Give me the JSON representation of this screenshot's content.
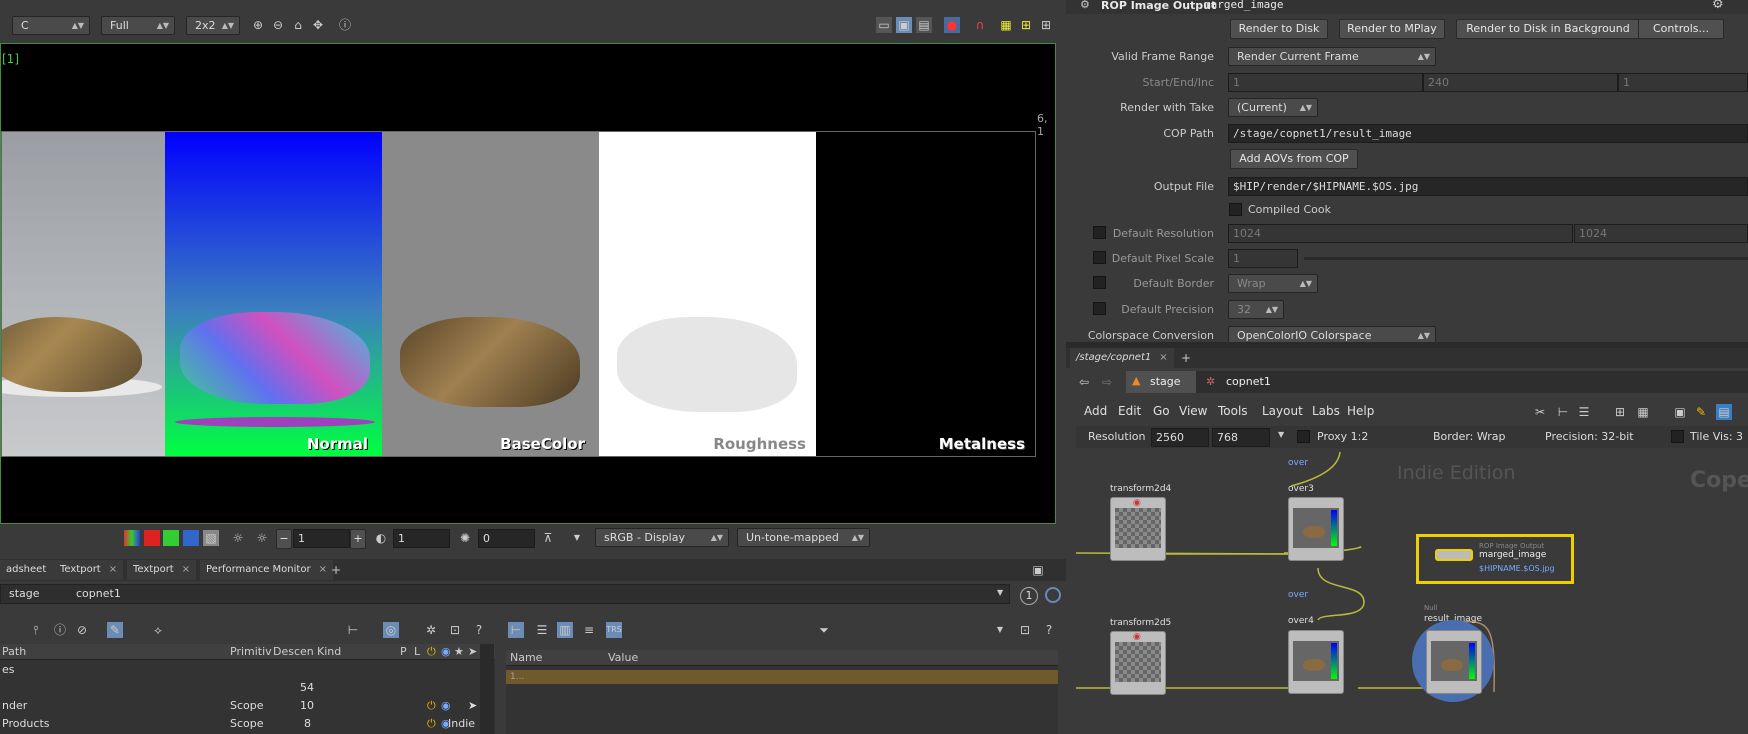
{
  "viewer_toolbar": {
    "channel": "C",
    "resolution": "Full",
    "layout": "2x2",
    "frame_label": "[1]",
    "coord_readout": "6, 1"
  },
  "viewer_images": {
    "labels": [
      "Normal",
      "BaseColor",
      "Roughness",
      "Metalness"
    ]
  },
  "viewer_bottom": {
    "value1": "1",
    "value2": "1",
    "value3": "0",
    "display": "sRGB - Display",
    "tonemap": "Un-tone-mapped"
  },
  "bottom_tabs": [
    {
      "label": "adsheet"
    },
    {
      "label": "Textport"
    },
    {
      "label": "Textport"
    },
    {
      "label": "Performance Monitor"
    }
  ],
  "bottom_path": {
    "stage": "stage",
    "copnet": "copnet1",
    "badge": "1"
  },
  "scene_table": {
    "headers": [
      "Path",
      "Primitiv",
      "Descen",
      "Kind",
      "P",
      "L"
    ],
    "rows": [
      {
        "path": "es",
        "prim": "",
        "desc": "",
        "kind": ""
      },
      {
        "path": "",
        "prim": "",
        "desc": "54",
        "kind": ""
      },
      {
        "path": "nder",
        "prim": "Scope",
        "desc": "10",
        "kind": ""
      },
      {
        "path": "Products",
        "prim": "Scope",
        "desc": "8",
        "kind": ""
      }
    ],
    "indie": "Indie"
  },
  "details_table": {
    "headers": [
      "Name",
      "Value"
    ],
    "placeholder": "1..."
  },
  "params": {
    "node_type": "ROP Image Output",
    "node_name": "marged_image",
    "buttons": [
      "Render to Disk",
      "Render to MPlay",
      "Render to Disk in Background",
      "Controls..."
    ],
    "valid_frame_range_label": "Valid Frame Range",
    "valid_frame_range": "Render Current Frame",
    "start_end_inc_label": "Start/End/Inc",
    "start": "1",
    "end": "240",
    "inc": "1",
    "render_with_take_label": "Render with Take",
    "render_with_take": "(Current)",
    "cop_path_label": "COP Path",
    "cop_path": "/stage/copnet1/result_image",
    "add_aovs": "Add AOVs from COP",
    "output_file_label": "Output File",
    "output_file": "$HIP/render/$HIPNAME.$OS.jpg",
    "compiled_cook": "Compiled Cook",
    "default_resolution_label": "Default Resolution",
    "res_x": "1024",
    "res_y": "1024",
    "default_pixel_scale_label": "Default Pixel Scale",
    "pixel_scale": "1",
    "default_border_label": "Default Border",
    "border": "Wrap",
    "default_precision_label": "Default Precision",
    "precision": "32",
    "colorspace_label": "Colorspace Conversion",
    "colorspace": "OpenColorIO Colorspace"
  },
  "network": {
    "tab_path": "/stage/copnet1",
    "crumb_stage": "stage",
    "crumb_copnet": "copnet1",
    "menu": [
      "Add",
      "Edit",
      "Go",
      "View",
      "Tools",
      "Layout",
      "Labs",
      "Help"
    ],
    "resolution_label": "Resolution",
    "res_w": "2560",
    "res_h": "768",
    "proxy": "Proxy 1:2",
    "border": "Border: Wrap",
    "precision": "Precision: 32-bit",
    "tile_vis": "Tile Vis: 3",
    "watermark": "Indie Edition",
    "watermark2": "Cope",
    "nodes": {
      "transform2d4": "transform2d4",
      "transform2d5": "transform2d5",
      "over3_type": "over",
      "over3": "over3",
      "over4_type": "over",
      "over4": "over4",
      "rop_type": "ROP Image Output",
      "rop_name": "marged_image",
      "rop_file": "$HIPNAME.$OS.jpg",
      "null_type": "Null",
      "result": "result_image"
    }
  }
}
